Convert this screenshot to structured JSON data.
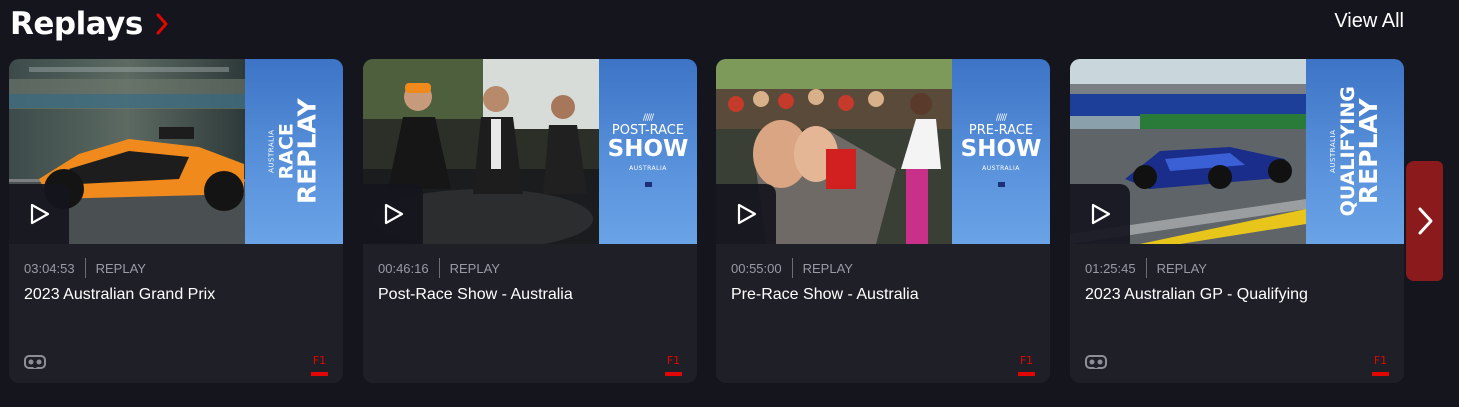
{
  "section": {
    "title": "Replays",
    "view_all": "View All"
  },
  "colors": {
    "accent": "#e10600",
    "background": "#15151e",
    "card": "#1f1f27",
    "meta_text": "#9a9aa6",
    "next_button": "#8a1a1c"
  },
  "cards": [
    {
      "duration": "03:04:53",
      "type": "REPLAY",
      "title": "2023 Australian Grand Prix",
      "badge": "F1",
      "panel": {
        "small": "AUSTRALIA",
        "line1": "RACE",
        "line2": "REPLAY"
      },
      "footer_icon": "vr-headset-icon"
    },
    {
      "duration": "00:46:16",
      "type": "REPLAY",
      "title": "Post-Race Show - Australia",
      "badge": "F1",
      "panel": {
        "line1": "POST-RACE",
        "line2": "SHOW",
        "small": "AUSTRALIA"
      },
      "footer_icon": null
    },
    {
      "duration": "00:55:00",
      "type": "REPLAY",
      "title": "Pre-Race Show - Australia",
      "badge": "F1",
      "panel": {
        "line1": "PRE-RACE",
        "line2": "SHOW",
        "small": "AUSTRALIA"
      },
      "footer_icon": null
    },
    {
      "duration": "01:25:45",
      "type": "REPLAY",
      "title": "2023 Australian GP - Qualifying",
      "badge": "F1",
      "panel": {
        "small": "AUSTRALIA",
        "line1": "QUALIFYING",
        "line2": "REPLAY"
      },
      "footer_icon": "vr-headset-icon"
    }
  ],
  "icons": {
    "play": "play-icon",
    "next": "chevron-right-icon",
    "title_chevron": "chevron-right-icon"
  }
}
